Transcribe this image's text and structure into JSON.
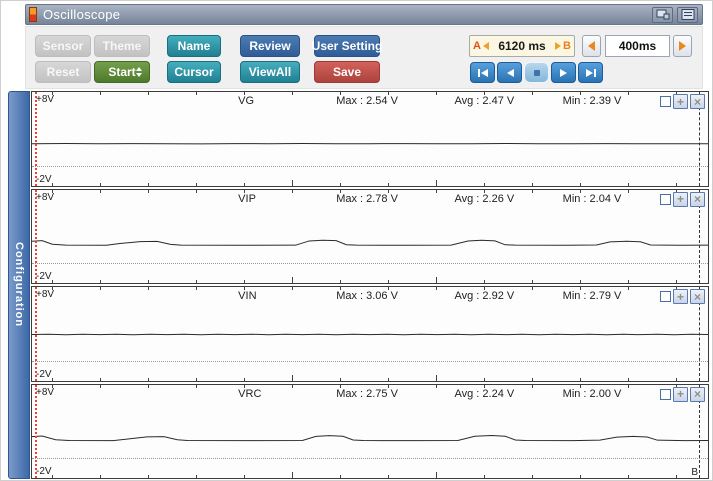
{
  "window": {
    "title": "Oscilloscope"
  },
  "toolbar": {
    "rows": [
      {
        "buttons": [
          {
            "label": "Sensor",
            "style": "disabled"
          },
          {
            "label": "Theme",
            "style": "disabled"
          },
          {
            "label": "Name",
            "style": "teal"
          },
          {
            "label": "Review",
            "style": "blue"
          },
          {
            "label": "User Setting",
            "style": "blue"
          }
        ]
      },
      {
        "buttons": [
          {
            "label": "Reset",
            "style": "disabled"
          },
          {
            "label": "Start",
            "style": "green",
            "has_spinner": true
          },
          {
            "label": "Cursor",
            "style": "teal"
          },
          {
            "label": "ViewAll",
            "style": "teal"
          },
          {
            "label": "Save",
            "style": "red"
          }
        ]
      }
    ],
    "range": {
      "a": "A",
      "b": "B",
      "value": "6120 ms"
    },
    "interval": "400ms",
    "playback": [
      "first",
      "previous",
      "stop",
      "next",
      "last"
    ]
  },
  "sidebar": {
    "label": "Configuration"
  },
  "cursors": {
    "b_label": "B"
  },
  "icons": {
    "plus": "+",
    "close": "×"
  },
  "channels": [
    {
      "name": "VG",
      "top_label": "+8V",
      "bottom_label": "-2V",
      "max": "Max : 2.54 V",
      "avg": "Avg : 2.47 V",
      "min": "Min : 2.39 V",
      "scale": {
        "top_volts": 8,
        "bottom_volts": -2
      },
      "waveform": [
        [
          0,
          2.47
        ],
        [
          0.05,
          2.49
        ],
        [
          0.1,
          2.46
        ],
        [
          0.15,
          2.48
        ],
        [
          0.2,
          2.47
        ],
        [
          0.25,
          2.45
        ],
        [
          0.3,
          2.48
        ],
        [
          0.35,
          2.47
        ],
        [
          0.4,
          2.49
        ],
        [
          0.45,
          2.46
        ],
        [
          0.5,
          2.47
        ],
        [
          0.55,
          2.48
        ],
        [
          0.6,
          2.46
        ],
        [
          0.65,
          2.47
        ],
        [
          0.7,
          2.49
        ],
        [
          0.75,
          2.47
        ],
        [
          0.8,
          2.46
        ],
        [
          0.85,
          2.48
        ],
        [
          0.9,
          2.47
        ],
        [
          0.95,
          2.46
        ],
        [
          1,
          2.47
        ]
      ]
    },
    {
      "name": "VIP",
      "top_label": "+8V",
      "bottom_label": "-2V",
      "max": "Max : 2.78 V",
      "avg": "Avg : 2.26 V",
      "min": "Min : 2.04 V",
      "scale": {
        "top_volts": 8,
        "bottom_volts": -2
      },
      "waveform": [
        [
          0,
          2.52
        ],
        [
          0.015,
          2.58
        ],
        [
          0.03,
          2.2
        ],
        [
          0.05,
          2.1
        ],
        [
          0.11,
          2.09
        ],
        [
          0.13,
          2.28
        ],
        [
          0.16,
          2.48
        ],
        [
          0.185,
          2.5
        ],
        [
          0.205,
          2.18
        ],
        [
          0.22,
          2.1
        ],
        [
          0.3,
          2.09
        ],
        [
          0.39,
          2.1
        ],
        [
          0.41,
          2.55
        ],
        [
          0.43,
          2.62
        ],
        [
          0.45,
          2.58
        ],
        [
          0.465,
          2.15
        ],
        [
          0.48,
          2.1
        ],
        [
          0.56,
          2.09
        ],
        [
          0.62,
          2.1
        ],
        [
          0.645,
          2.55
        ],
        [
          0.665,
          2.62
        ],
        [
          0.685,
          2.56
        ],
        [
          0.7,
          2.14
        ],
        [
          0.715,
          2.1
        ],
        [
          0.79,
          2.09
        ],
        [
          0.835,
          2.12
        ],
        [
          0.855,
          2.45
        ],
        [
          0.88,
          2.52
        ],
        [
          0.9,
          2.46
        ],
        [
          0.915,
          2.12
        ],
        [
          0.96,
          2.09
        ],
        [
          1,
          2.1
        ]
      ]
    },
    {
      "name": "VIN",
      "top_label": "+8V",
      "bottom_label": "-2V",
      "max": "Max : 3.06 V",
      "avg": "Avg : 2.92 V",
      "min": "Min : 2.79 V",
      "scale": {
        "top_volts": 8,
        "bottom_volts": -2
      },
      "waveform": [
        [
          0,
          2.92
        ],
        [
          0.025,
          2.95
        ],
        [
          0.05,
          2.89
        ],
        [
          0.075,
          2.94
        ],
        [
          0.1,
          2.9
        ],
        [
          0.125,
          2.95
        ],
        [
          0.15,
          2.89
        ],
        [
          0.175,
          2.94
        ],
        [
          0.2,
          2.9
        ],
        [
          0.225,
          2.95
        ],
        [
          0.25,
          2.89
        ],
        [
          0.275,
          2.94
        ],
        [
          0.3,
          2.9
        ],
        [
          0.325,
          2.95
        ],
        [
          0.35,
          2.89
        ],
        [
          0.375,
          2.94
        ],
        [
          0.4,
          2.9
        ],
        [
          0.425,
          2.95
        ],
        [
          0.45,
          2.89
        ],
        [
          0.475,
          2.94
        ],
        [
          0.5,
          2.9
        ],
        [
          0.525,
          2.95
        ],
        [
          0.55,
          2.89
        ],
        [
          0.575,
          2.94
        ],
        [
          0.6,
          2.9
        ],
        [
          0.625,
          2.95
        ],
        [
          0.65,
          2.89
        ],
        [
          0.675,
          2.94
        ],
        [
          0.7,
          2.9
        ],
        [
          0.725,
          2.95
        ],
        [
          0.75,
          2.89
        ],
        [
          0.775,
          2.94
        ],
        [
          0.8,
          2.9
        ],
        [
          0.825,
          2.95
        ],
        [
          0.85,
          2.89
        ],
        [
          0.875,
          2.94
        ],
        [
          0.9,
          2.9
        ],
        [
          0.925,
          2.95
        ],
        [
          0.95,
          2.89
        ],
        [
          0.975,
          2.94
        ],
        [
          1,
          2.92
        ]
      ]
    },
    {
      "name": "VRC",
      "top_label": "+8V",
      "bottom_label": "-2V",
      "max": "Max : 2.75 V",
      "avg": "Avg : 2.24 V",
      "min": "Min : 2.00 V",
      "scale": {
        "top_volts": 8,
        "bottom_volts": -2
      },
      "waveform": [
        [
          0,
          2.48
        ],
        [
          0.015,
          2.55
        ],
        [
          0.035,
          2.15
        ],
        [
          0.055,
          2.06
        ],
        [
          0.12,
          2.05
        ],
        [
          0.145,
          2.25
        ],
        [
          0.17,
          2.45
        ],
        [
          0.195,
          2.48
        ],
        [
          0.215,
          2.15
        ],
        [
          0.23,
          2.06
        ],
        [
          0.32,
          2.05
        ],
        [
          0.4,
          2.06
        ],
        [
          0.42,
          2.5
        ],
        [
          0.44,
          2.58
        ],
        [
          0.46,
          2.52
        ],
        [
          0.475,
          2.12
        ],
        [
          0.49,
          2.06
        ],
        [
          0.57,
          2.05
        ],
        [
          0.63,
          2.06
        ],
        [
          0.655,
          2.52
        ],
        [
          0.68,
          2.6
        ],
        [
          0.7,
          2.52
        ],
        [
          0.715,
          2.12
        ],
        [
          0.73,
          2.06
        ],
        [
          0.8,
          2.05
        ],
        [
          0.84,
          2.1
        ],
        [
          0.865,
          2.42
        ],
        [
          0.89,
          2.5
        ],
        [
          0.91,
          2.44
        ],
        [
          0.925,
          2.1
        ],
        [
          0.965,
          2.05
        ],
        [
          1,
          2.06
        ]
      ]
    }
  ],
  "colors": {
    "accent_teal": "#2d96a4",
    "accent_blue": "#3a6ea5",
    "accent_green": "#5d8a38",
    "accent_red": "#bf4d47",
    "disabled_gray": "#c9c9c9",
    "playback_blue": "#2f7fc1",
    "orange": "#e8821e",
    "cursor_a_red": "#e8442e",
    "titlebar_gray": "#8795a8",
    "range_box_bg": "#fbf7e2"
  }
}
